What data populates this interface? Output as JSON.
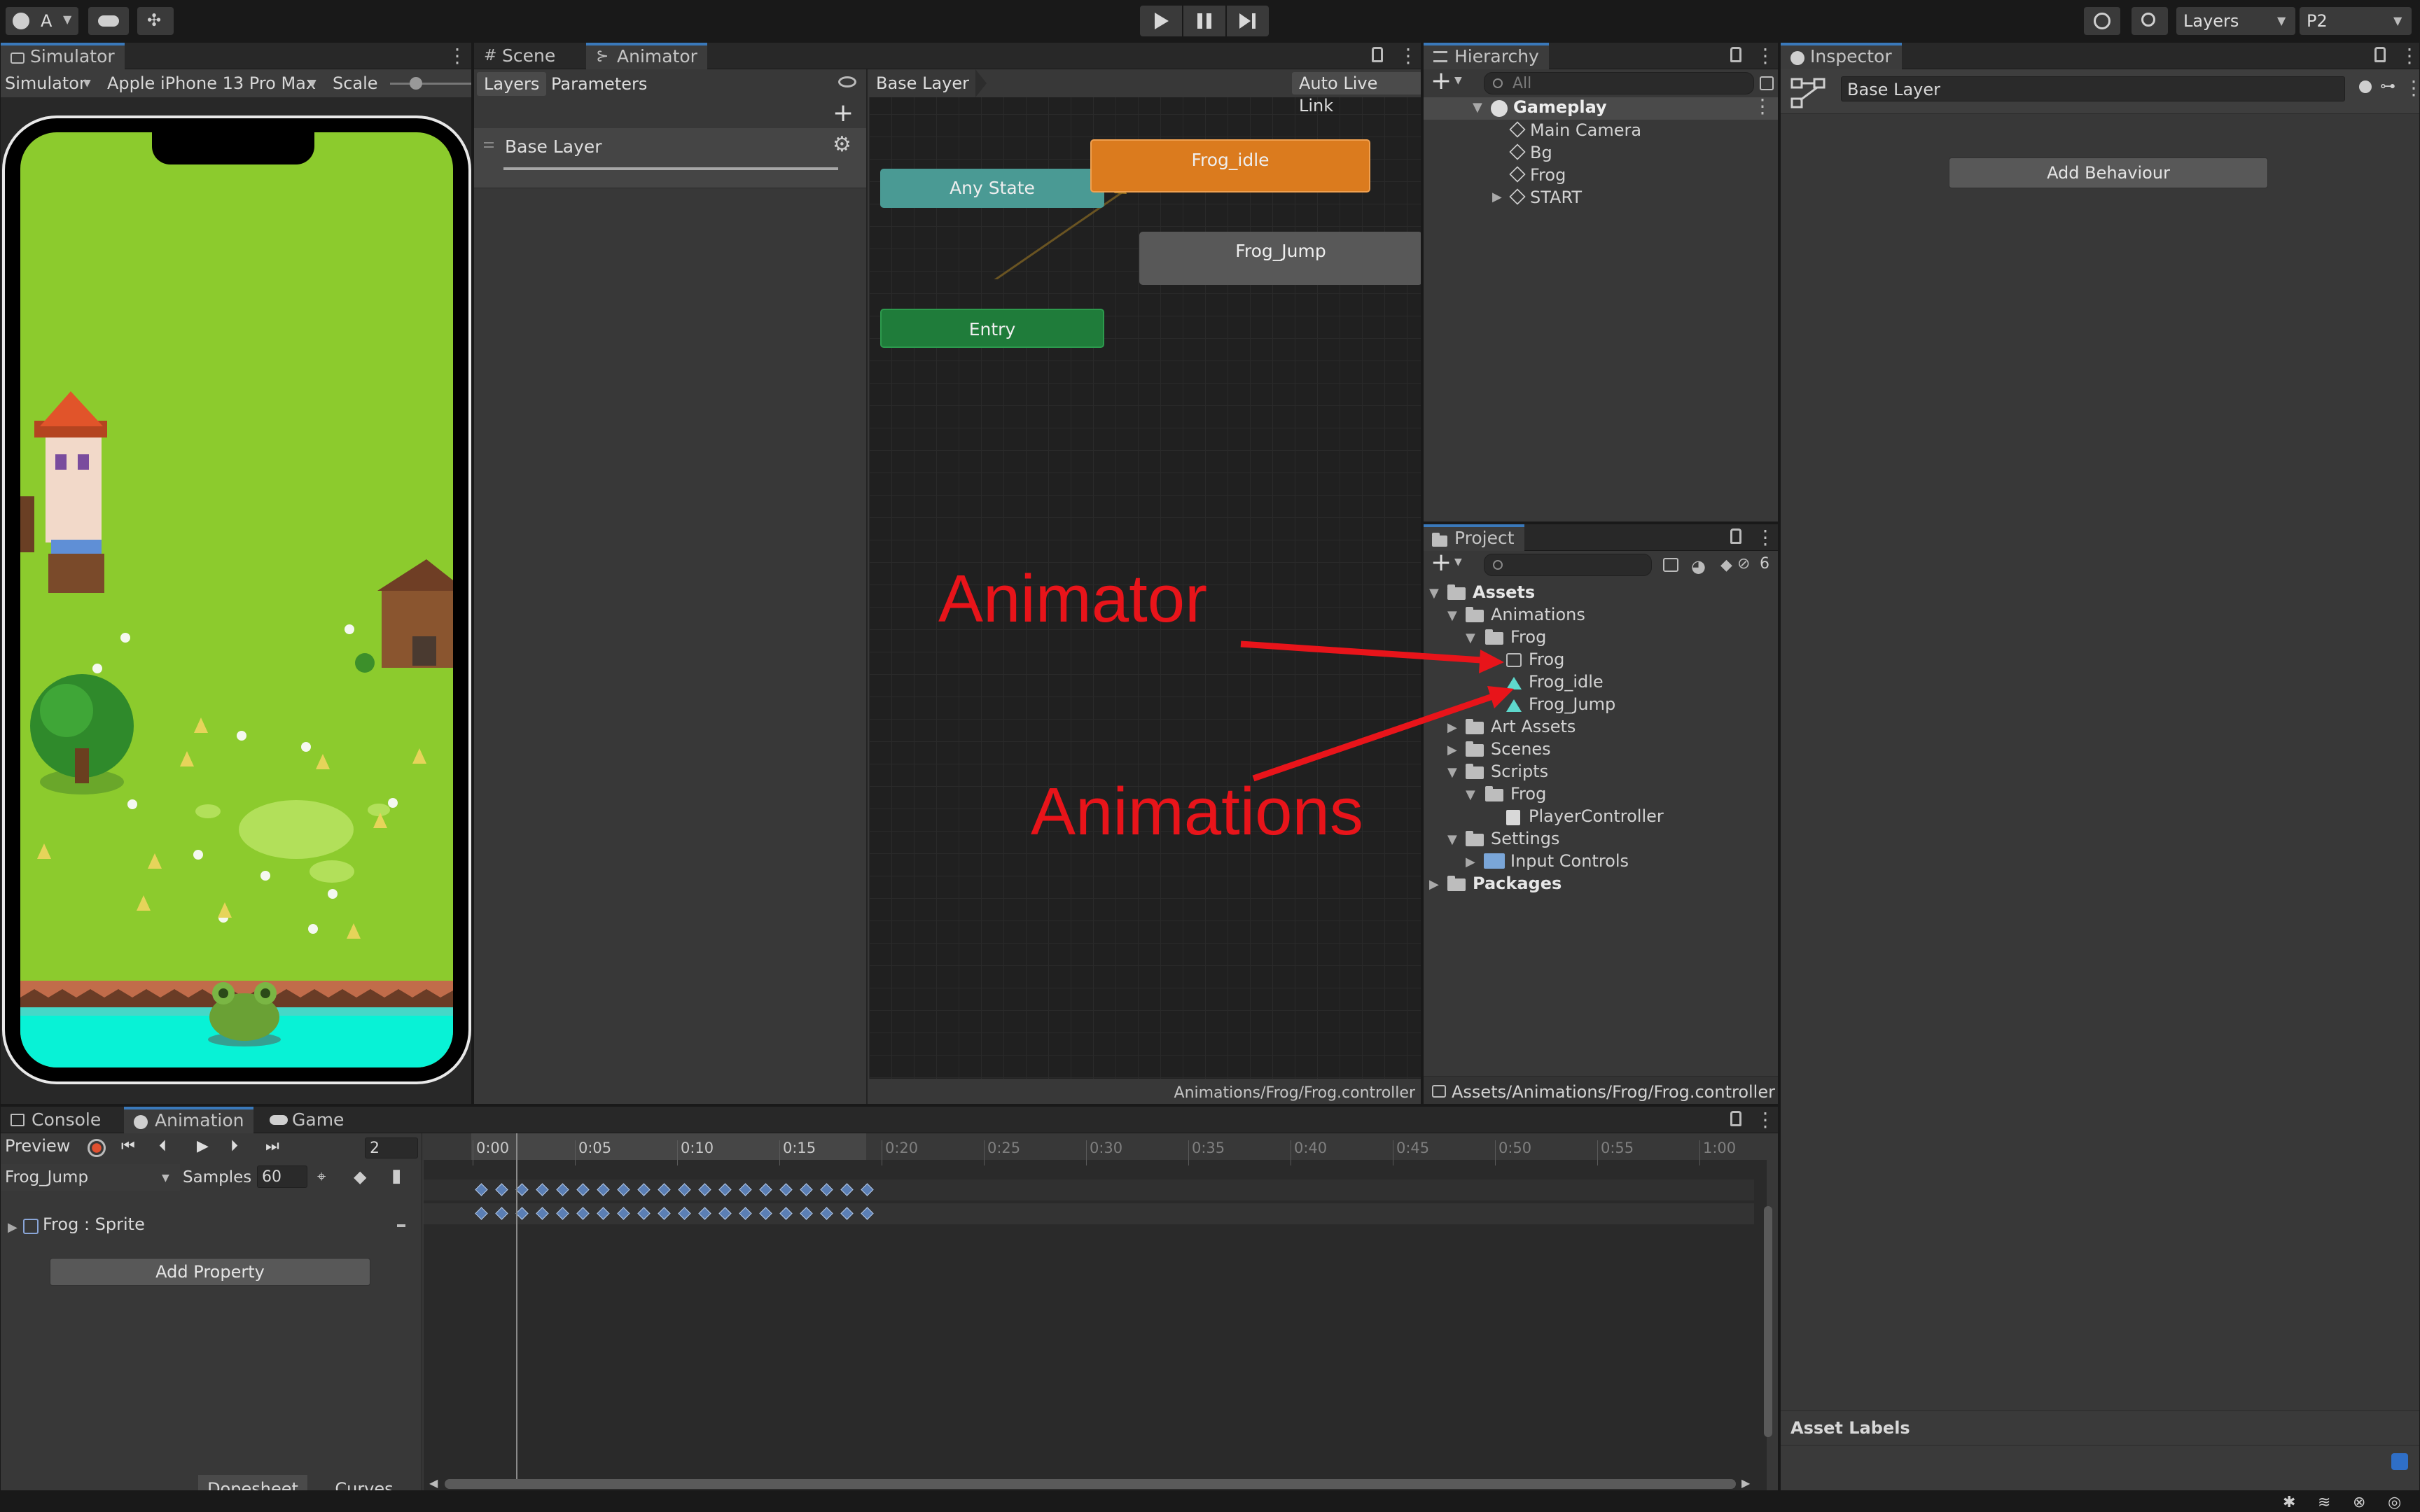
{
  "toolbar": {
    "account": "A",
    "layers": "Layers",
    "layout": "P2"
  },
  "simulator": {
    "tab": "Simulator",
    "mode": "Simulator",
    "device": "Apple iPhone 13 Pro Max",
    "scale_label": "Scale"
  },
  "animator": {
    "tabs": [
      "Scene",
      "Animator"
    ],
    "subtabs": [
      "Layers",
      "Parameters"
    ],
    "breadcrumb": "Base Layer",
    "live_link": "Auto Live Link",
    "layer_item": "Base Layer",
    "footer_path": "Animations/Frog/Frog.controller",
    "nodes": {
      "any_state": "Any State",
      "idle": "Frog_idle",
      "jump": "Frog_Jump",
      "entry": "Entry"
    }
  },
  "hierarchy": {
    "tab": "Hierarchy",
    "search_placeholder": "All",
    "root": "Gameplay",
    "items": [
      "Main Camera",
      "Bg",
      "Frog",
      "START"
    ]
  },
  "inspector": {
    "tab": "Inspector",
    "title": "Base Layer",
    "add_behaviour": "Add Behaviour",
    "asset_labels": "Asset Labels"
  },
  "project": {
    "tab": "Project",
    "visible_count": "6",
    "footer_path": "Assets/Animations/Frog/Frog.controller",
    "tree": {
      "assets": "Assets",
      "animations": "Animations",
      "frog": "Frog",
      "frog_controller": "Frog",
      "frog_idle": "Frog_idle",
      "frog_jump": "Frog_Jump",
      "art_assets": "Art Assets",
      "scenes": "Scenes",
      "scripts": "Scripts",
      "scripts_frog": "Frog",
      "player_controller": "PlayerController",
      "settings": "Settings",
      "input_controls": "Input Controls",
      "packages": "Packages"
    }
  },
  "annotations": {
    "animator": "Animator",
    "animations": "Animations",
    "color": "#e8141a"
  },
  "animation_panel": {
    "tabs": [
      "Console",
      "Animation",
      "Game"
    ],
    "preview": "Preview",
    "frame": "2",
    "clip": "Frog_Jump",
    "samples_label": "Samples",
    "samples": "60",
    "property": "Frog : Sprite",
    "add_property": "Add Property",
    "dopesheet": "Dopesheet",
    "curves": "Curves",
    "ticks": [
      "0:00",
      "0:05",
      "0:10",
      "0:15",
      "0:20",
      "0:25",
      "0:30",
      "0:35",
      "0:40",
      "0:45",
      "0:50",
      "0:55",
      "1:00"
    ]
  }
}
